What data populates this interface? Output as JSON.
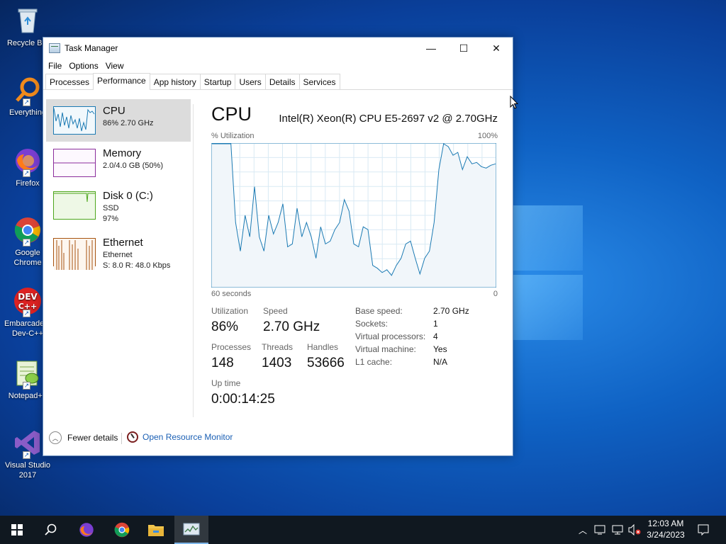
{
  "desktop": {
    "icons": [
      {
        "label": "Recycle Bin",
        "icon": "recycle-bin-icon"
      },
      {
        "label": "Everything",
        "icon": "everything-search-icon"
      },
      {
        "label": "Firefox",
        "icon": "firefox-icon"
      },
      {
        "label": "Google\nChrome",
        "icon": "chrome-icon"
      },
      {
        "label": "Embarcadero\nDev-C++",
        "icon": "devcpp-icon"
      },
      {
        "label": "Notepad++",
        "icon": "notepadpp-icon"
      },
      {
        "label": "Visual Studio\n2017",
        "icon": "visual-studio-icon"
      }
    ]
  },
  "window": {
    "title": "Task Manager",
    "controls": {
      "minimize": "—",
      "maximize": "☐",
      "close": "✕"
    }
  },
  "menu": [
    "File",
    "Options",
    "View"
  ],
  "tabs": [
    "Processes",
    "Performance",
    "App history",
    "Startup",
    "Users",
    "Details",
    "Services"
  ],
  "active_tab": "Performance",
  "sidebar": [
    {
      "title": "CPU",
      "lines": [
        "86%  2.70 GHz"
      ],
      "color": "#1b7ab3"
    },
    {
      "title": "Memory",
      "lines": [
        "2.0/4.0 GB (50%)"
      ],
      "color": "#8b2d9c"
    },
    {
      "title": "Disk 0 (C:)",
      "lines": [
        "SSD",
        "97%"
      ],
      "color": "#4da61c"
    },
    {
      "title": "Ethernet",
      "lines": [
        "Ethernet",
        "S: 8.0  R: 48.0 Kbps"
      ],
      "color": "#a7530f"
    }
  ],
  "main": {
    "heading": "CPU",
    "model": "Intel(R) Xeon(R) CPU E5-2697 v2 @ 2.70GHz",
    "util_label": "% Utilization",
    "util_max": "100%",
    "time_label": "60 seconds",
    "time_zero": "0",
    "stats": {
      "utilization": {
        "label": "Utilization",
        "value": "86%"
      },
      "speed": {
        "label": "Speed",
        "value": "2.70 GHz"
      },
      "processes": {
        "label": "Processes",
        "value": "148"
      },
      "threads": {
        "label": "Threads",
        "value": "1403"
      },
      "handles": {
        "label": "Handles",
        "value": "53666"
      },
      "uptime": {
        "label": "Up time",
        "value": "0:00:14:25"
      }
    },
    "properties": [
      {
        "key": "Base speed:",
        "value": "2.70 GHz"
      },
      {
        "key": "Sockets:",
        "value": "1"
      },
      {
        "key": "Virtual processors:",
        "value": "4"
      },
      {
        "key": "Virtual machine:",
        "value": "Yes"
      },
      {
        "key": "L1 cache:",
        "value": "N/A"
      }
    ]
  },
  "footer": {
    "fewer_details": "Fewer details",
    "resource_monitor": "Open Resource Monitor"
  },
  "taskbar": {
    "time": "12:03 AM",
    "date": "3/24/2023",
    "apps": [
      "start-icon",
      "search-icon",
      "firefox-icon",
      "chrome-icon",
      "file-explorer-icon",
      "task-manager-icon"
    ]
  },
  "chart_data": {
    "type": "line",
    "title": "CPU % Utilization",
    "xlabel": "60 seconds",
    "ylim": [
      0,
      100
    ],
    "x": [
      60,
      59,
      58,
      57,
      56,
      55,
      54,
      53,
      52,
      51,
      50,
      49,
      48,
      47,
      46,
      45,
      44,
      43,
      42,
      41,
      40,
      39,
      38,
      37,
      36,
      35,
      34,
      33,
      32,
      31,
      30,
      29,
      28,
      27,
      26,
      25,
      24,
      23,
      22,
      21,
      20,
      19,
      18,
      17,
      16,
      15,
      14,
      13,
      12,
      11,
      10,
      9,
      8,
      7,
      6,
      5,
      4,
      3,
      2,
      1,
      0
    ],
    "series": [
      {
        "name": "CPU",
        "color": "#1b7ab3",
        "values": [
          100,
          100,
          100,
          100,
          100,
          45,
          25,
          50,
          35,
          70,
          35,
          25,
          50,
          37,
          45,
          58,
          28,
          30,
          55,
          35,
          45,
          35,
          20,
          42,
          30,
          32,
          40,
          45,
          61,
          53,
          30,
          28,
          42,
          40,
          15,
          13,
          10,
          12,
          8,
          15,
          20,
          30,
          32,
          20,
          9,
          20,
          25,
          45,
          82,
          100,
          98,
          92,
          94,
          82,
          91,
          86,
          87,
          84,
          83,
          85,
          86
        ]
      }
    ]
  }
}
